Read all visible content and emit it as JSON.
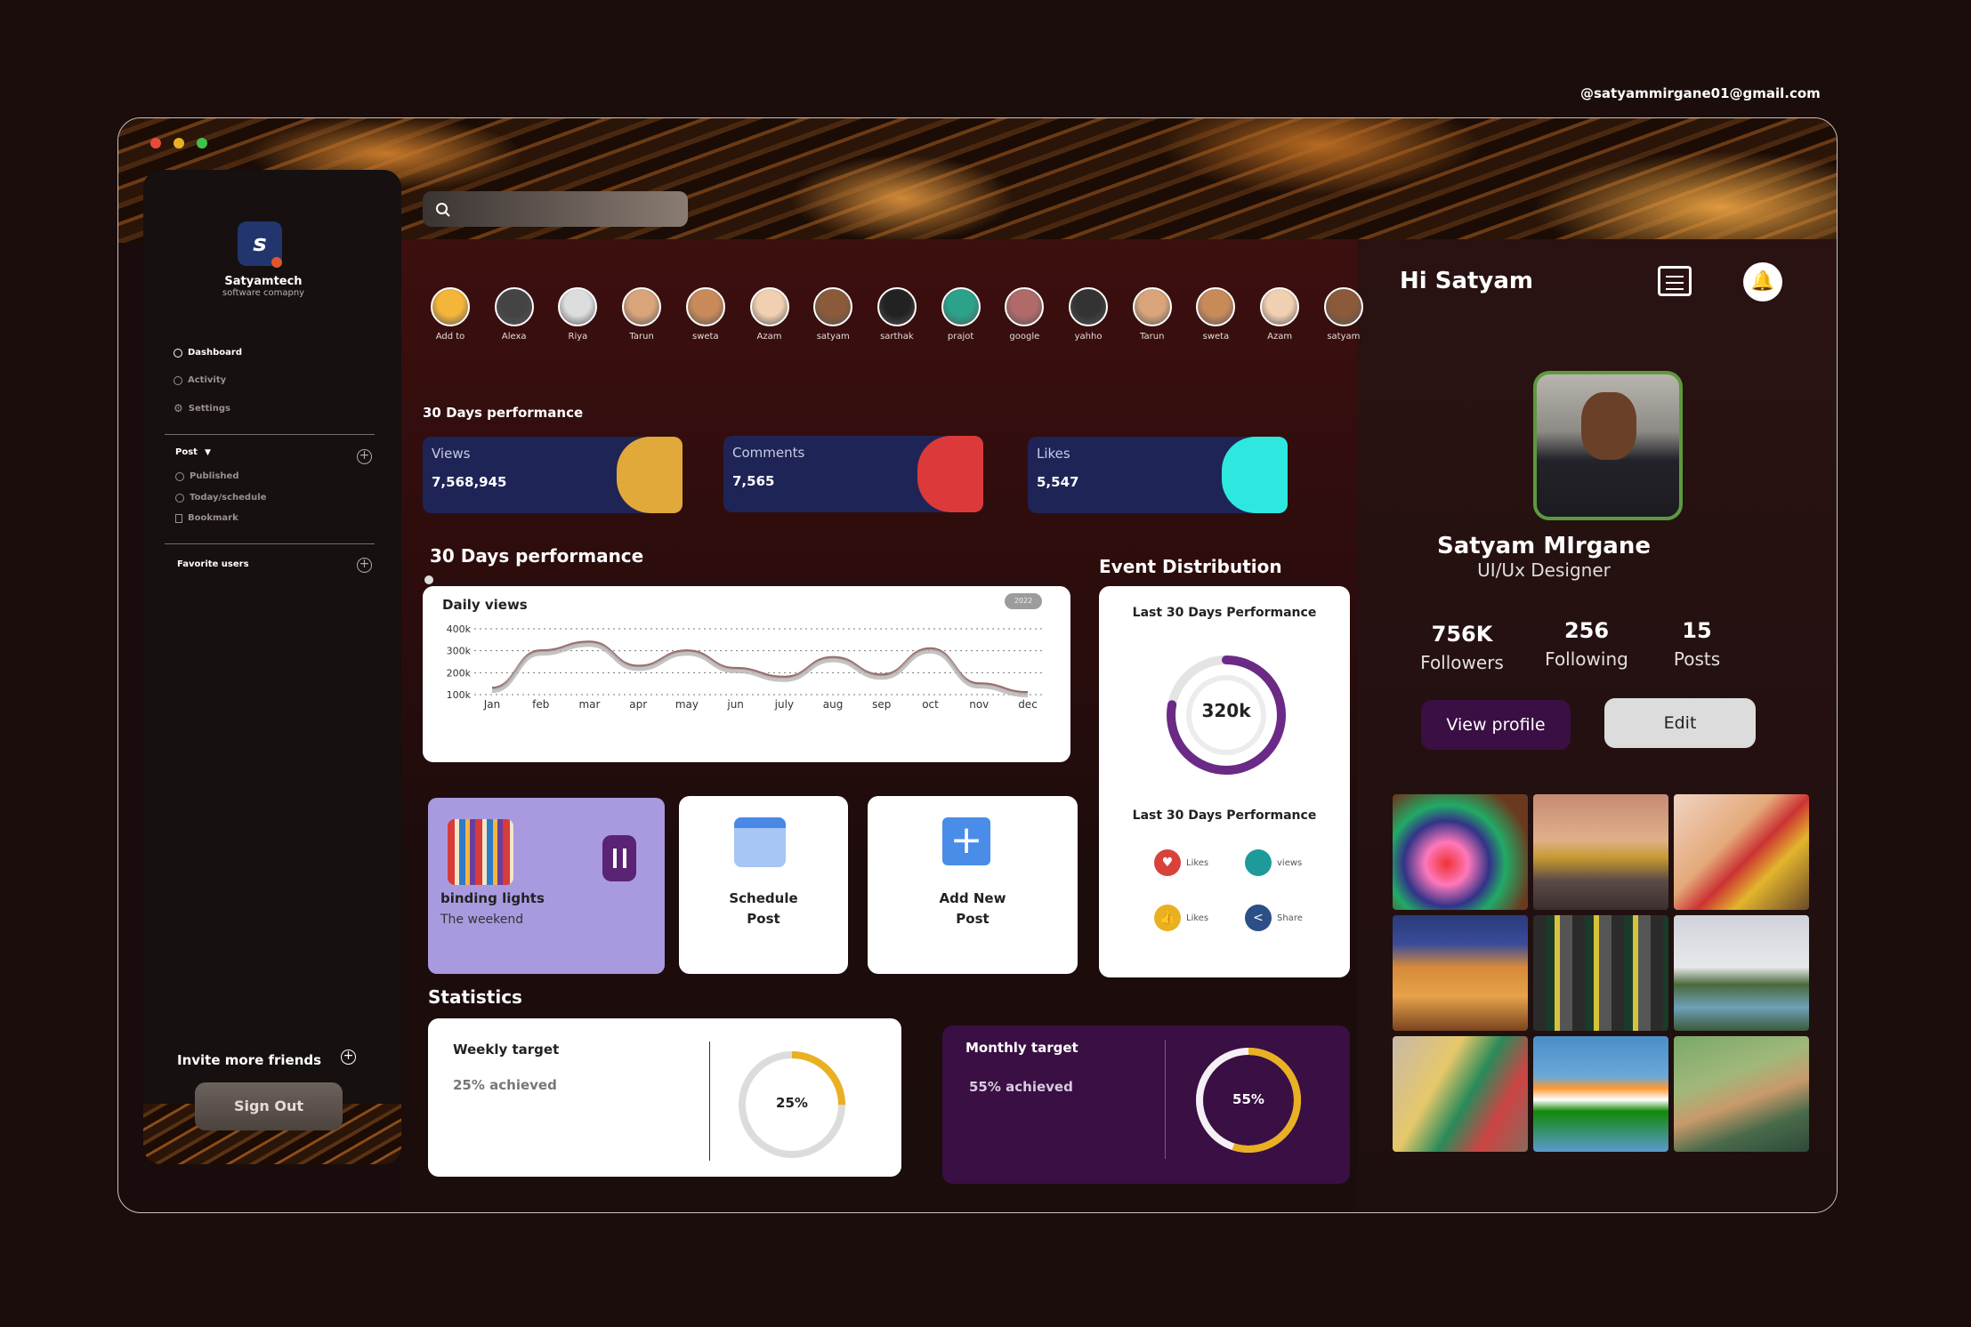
{
  "email": "@satyammirgane01@gmail.com",
  "brand": {
    "name": "Satyamtech",
    "tagline": "software comapny",
    "logo_letter": "s"
  },
  "nav": {
    "dashboard": "Dashboard",
    "activity": "Activity",
    "settings": "Settings"
  },
  "post": {
    "label": "Post",
    "published": "Published",
    "today": "Today/schedule",
    "bookmark": "Bookmark"
  },
  "favorites": "Favorite users",
  "invite": "Invite more friends",
  "signout": "Sign Out",
  "stories": [
    "Add to",
    "Alexa",
    "Riya",
    "Tarun",
    "sweta",
    "Azam",
    "satyam",
    "sarthak",
    "prajot",
    "google",
    "yahho",
    "Tarun",
    "sweta",
    "Azam",
    "satyam"
  ],
  "perf_title": "30  Days performance",
  "perf_cards": [
    {
      "label": "Views",
      "value": "7,568,945",
      "color": "#e1a93a"
    },
    {
      "label": "Comments",
      "value": "7,565",
      "color": "#dc3a3a"
    },
    {
      "label": "Likes",
      "value": "5,547",
      "color": "#2ee8e0"
    }
  ],
  "chart_section_title": "30  Days performance",
  "chart_data": {
    "type": "line",
    "title": "Daily views",
    "badge": "2022",
    "categories": [
      "Jan",
      "feb",
      "mar",
      "apr",
      "may",
      "jun",
      "july",
      "aug",
      "sep",
      "oct",
      "nov",
      "dec"
    ],
    "y_ticks": [
      "400k",
      "300k",
      "200k",
      "100k"
    ],
    "ylim": [
      100000,
      400000
    ],
    "values": [
      130000,
      300000,
      340000,
      230000,
      300000,
      220000,
      180000,
      270000,
      190000,
      310000,
      150000,
      110000
    ]
  },
  "music": {
    "title": "binding lights",
    "artist": "The weekend"
  },
  "schedule": {
    "line1": "Schedule",
    "line2": "Post"
  },
  "addnew": {
    "line1": "Add New",
    "line2": "Post"
  },
  "event": {
    "title": "Event Distribution",
    "sub1": "Last 30  Days Performance",
    "center": "320k",
    "donut_fraction": 0.78,
    "sub2": "Last 30  Days Performance",
    "legend": [
      {
        "label": "Likes",
        "color": "#d8423a"
      },
      {
        "label": "views",
        "color": "#1f9a9a"
      },
      {
        "label": "Likes",
        "color": "#e9b021"
      },
      {
        "label": "Share",
        "color": "#2b4f86"
      }
    ]
  },
  "stats": {
    "title": "Statistics",
    "weekly": {
      "title": "Weekly target",
      "sub": "25% achieved",
      "pct": "25%",
      "fraction": 0.25
    },
    "monthly": {
      "title": "Monthly target",
      "sub": "55% achieved",
      "pct": "55%",
      "fraction": 0.55
    }
  },
  "profile": {
    "greet": "Hi Satyam",
    "name": "Satyam MIrgane",
    "role": "UI/Ux Designer",
    "followers": "756K",
    "followers_lbl": "Followers",
    "following": "256",
    "following_lbl": "Following",
    "posts": "15",
    "posts_lbl": "Posts",
    "view_btn": "View profile",
    "edit_btn": "Edit"
  },
  "colors": {
    "accent_purple": "#3a0f43",
    "navy": "#1f2456",
    "gold": "#e9b021"
  }
}
